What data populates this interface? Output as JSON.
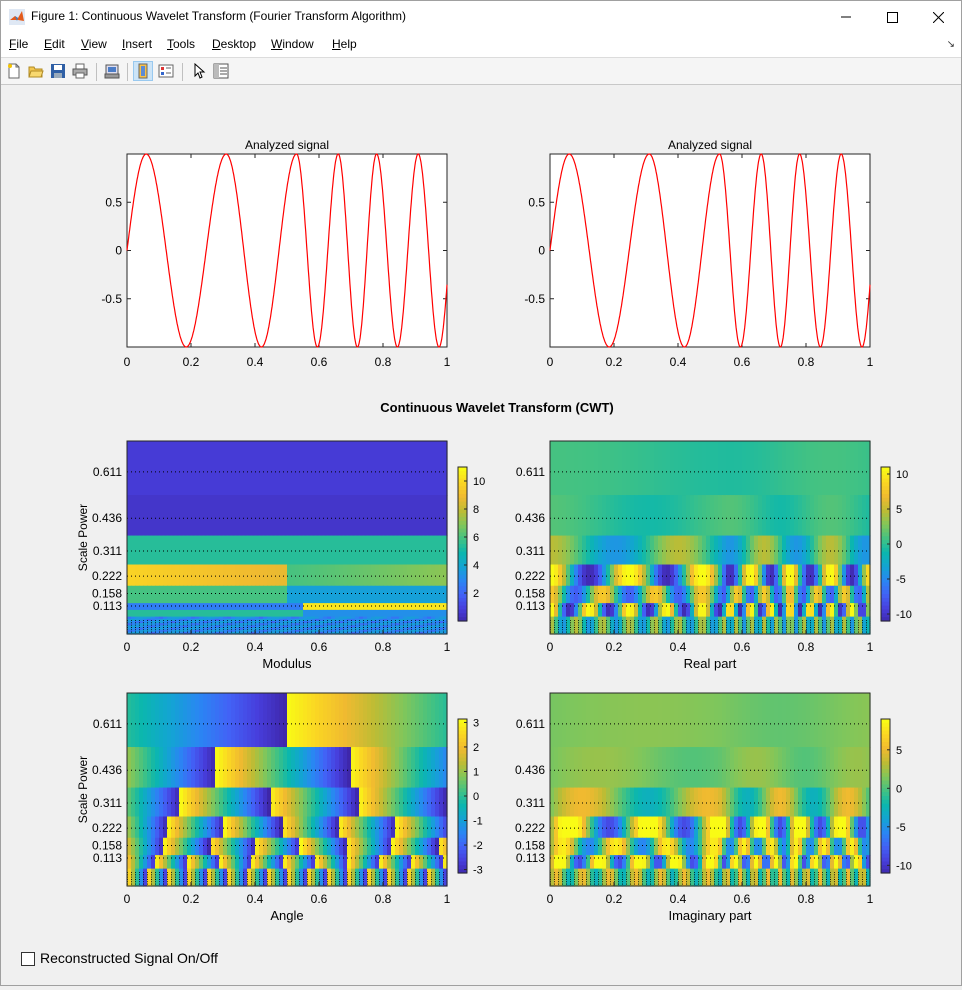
{
  "window": {
    "title": "Figure 1: Continuous Wavelet Transform (Fourier Transform Algorithm)",
    "icon": "matlab-icon",
    "minimize": "minimize-icon",
    "maximize": "maximize-icon",
    "close": "close-icon"
  },
  "menubar": {
    "items": [
      {
        "label": "File",
        "key": "F"
      },
      {
        "label": "Edit",
        "key": "E"
      },
      {
        "label": "View",
        "key": "V"
      },
      {
        "label": "Insert",
        "key": "I"
      },
      {
        "label": "Tools",
        "key": "T"
      },
      {
        "label": "Desktop",
        "key": "D"
      },
      {
        "label": "Window",
        "key": "W"
      },
      {
        "label": "Help",
        "key": "H"
      }
    ]
  },
  "toolbar": {
    "buttons": [
      "new-figure-icon",
      "open-file-icon",
      "save-icon",
      "print-icon",
      "print-preview-icon",
      "link-plot-icon",
      "insert-colorbar-icon",
      "edit-plot-arrow-icon",
      "property-inspector-icon"
    ]
  },
  "figure": {
    "suptitle": "Continuous Wavelet Transform (CWT)",
    "ylabel": "Scale Power",
    "xticks": [
      "0",
      "0.2",
      "0.4",
      "0.6",
      "0.8",
      "1"
    ],
    "scale_ticks": [
      "0.611",
      "0.436",
      "0.311",
      "0.222",
      "0.158",
      "0.113"
    ],
    "colors": {
      "signal": "#ff0000",
      "low": "#3e26a8",
      "high": "#f9fb15"
    }
  },
  "chart_data": [
    {
      "type": "line",
      "title": "Analyzed signal",
      "xlim": [
        0,
        1
      ],
      "ylim": [
        -1,
        1
      ],
      "yticks": [
        "0.5",
        "0",
        "-0.5"
      ],
      "series": [
        {
          "x_peaks": [
            0.06,
            0.31,
            0.53,
            0.66,
            0.78,
            0.91
          ],
          "amplitude": 1
        }
      ]
    },
    {
      "type": "line",
      "title": "Analyzed signal",
      "xlim": [
        0,
        1
      ],
      "ylim": [
        -1,
        1
      ],
      "yticks": [
        "0.5",
        "0",
        "-0.5"
      ],
      "series": [
        {
          "x_peaks": [
            0.06,
            0.31,
            0.53,
            0.66,
            0.78,
            0.91
          ],
          "amplitude": 1
        }
      ]
    },
    {
      "type": "heatmap",
      "xlabel": "Modulus",
      "colorbar": [
        "10",
        "8",
        "6",
        "4",
        "2"
      ],
      "clim": [
        0,
        11
      ]
    },
    {
      "type": "heatmap",
      "xlabel": "Real part",
      "colorbar": [
        "10",
        "5",
        "0",
        "-5",
        "-10"
      ],
      "clim": [
        -11,
        11
      ]
    },
    {
      "type": "heatmap",
      "xlabel": "Angle",
      "colorbar": [
        "3",
        "2",
        "1",
        "0",
        "-1",
        "-2",
        "-3"
      ],
      "clim": [
        -3.14,
        3.14
      ]
    },
    {
      "type": "heatmap",
      "xlabel": "Imaginary part",
      "colorbar": [
        "5",
        "0",
        "-5",
        "-10"
      ],
      "clim": [
        -11,
        9
      ]
    }
  ],
  "controls": {
    "checkbox_label": "Reconstructed Signal On/Off",
    "checked": false
  }
}
